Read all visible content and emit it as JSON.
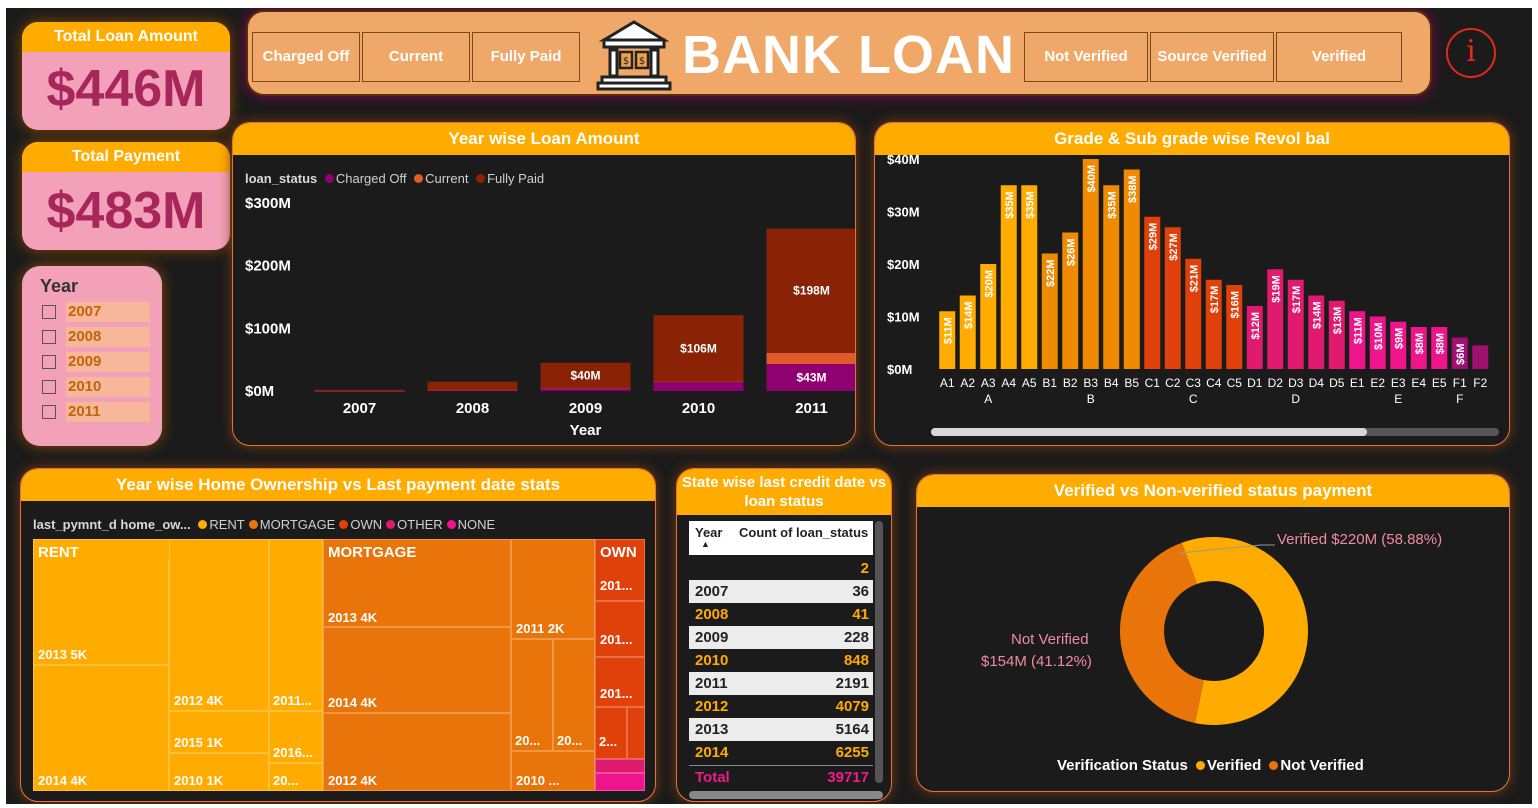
{
  "kpis": {
    "total_loan_label": "Total Loan Amount",
    "total_loan_value": "$446M",
    "total_payment_label": "Total Payment",
    "total_payment_value": "$483M"
  },
  "year_slicer": {
    "title": "Year",
    "options": [
      "2007",
      "2008",
      "2009",
      "2010",
      "2011"
    ]
  },
  "header": {
    "title": "BANK LOAN",
    "status_buttons": [
      "Charged Off",
      "Current",
      "Fully Paid"
    ],
    "verification_buttons": [
      "Not Verified",
      "Source Verified",
      "Verified"
    ],
    "info_icon": "i"
  },
  "colors": {
    "accent": "#ffab00",
    "charged_off": "#8f0070",
    "current": "#e05a2a",
    "fully_paid": "#8a2206",
    "kpi_bg": "#f3a1b9",
    "kpi_text": "#a8275a"
  },
  "year_chart": {
    "title": "Year wise Loan Amount",
    "legend_title": "loan_status",
    "legend": [
      "Charged Off",
      "Current",
      "Fully Paid"
    ],
    "xlabel": "Year",
    "yticks": [
      "$300M",
      "$200M",
      "$100M",
      "$0M"
    ]
  },
  "grade_chart": {
    "title": "Grade & Sub grade wise Revol bal",
    "yticks": [
      "$40M",
      "$30M",
      "$20M",
      "$10M",
      "$0M"
    ],
    "groups": [
      "A",
      "B",
      "C",
      "D",
      "E",
      "F"
    ]
  },
  "treemap": {
    "title": "Year wise Home Ownership vs Last payment date stats",
    "legend_title": "last_pymnt_d home_ow...",
    "legend": [
      "RENT",
      "MORTGAGE",
      "OWN",
      "OTHER",
      "NONE"
    ],
    "legend_colors": [
      "#ffab00",
      "#e8740a",
      "#e0400a",
      "#e01a6e",
      "#f0148c"
    ],
    "groups": [
      "RENT",
      "MORTGAGE",
      "OWN"
    ],
    "labels": {
      "rent_2013": "2013 5K",
      "rent_2014": "2014 4K",
      "rent_2012": "2012 4K",
      "rent_2011": "2011...",
      "rent_2015": "2015 1K",
      "rent_2016": "2016...",
      "rent_2010": "2010 1K",
      "rent_20x": "20...",
      "mort_2013": "2013 4K",
      "mort_2014": "2014 4K",
      "mort_2012": "2012 4K",
      "mort_2011": "2011 2K",
      "mort_20a": "20...",
      "mort_20b": "20...",
      "mort_2010": "2010 ...",
      "own_a": "201...",
      "own_b": "201...",
      "own_c": "201...",
      "own_d": "2..."
    }
  },
  "state_table": {
    "title": "State wise last credit date vs loan status",
    "headers": [
      "Year",
      "Count of loan_status"
    ],
    "rows": [
      {
        "year": "",
        "count": "2"
      },
      {
        "year": "2007",
        "count": "36"
      },
      {
        "year": "2008",
        "count": "41"
      },
      {
        "year": "2009",
        "count": "228"
      },
      {
        "year": "2010",
        "count": "848"
      },
      {
        "year": "2011",
        "count": "2191"
      },
      {
        "year": "2012",
        "count": "4079"
      },
      {
        "year": "2013",
        "count": "5164"
      },
      {
        "year": "2014",
        "count": "6255"
      }
    ],
    "total_label": "Total",
    "total_value": "39717"
  },
  "donut": {
    "title": "Verified vs Non-verified status payment",
    "verified_label": "Verified $220M (58.88%)",
    "not_verified_line1": "Not Verified",
    "not_verified_line2": "$154M (41.12%)",
    "legend_title": "Verification Status",
    "legend": [
      "Verified",
      "Not Verified"
    ]
  },
  "chart_data": [
    {
      "type": "bar",
      "title": "Year wise Loan Amount",
      "xlabel": "Year",
      "ylabel": "",
      "categories": [
        "2007",
        "2008",
        "2009",
        "2010",
        "2011"
      ],
      "series": [
        {
          "name": "Charged Off",
          "values": [
            0.3,
            2,
            5,
            15,
            43
          ]
        },
        {
          "name": "Current",
          "values": [
            0,
            0,
            0,
            0,
            18
          ]
        },
        {
          "name": "Fully Paid",
          "values": [
            1.5,
            13,
            40,
            106,
            198
          ]
        }
      ],
      "data_labels": [
        "",
        "",
        "$40M",
        "$106M",
        "$198M",
        "$43M"
      ],
      "ylim": [
        0,
        300
      ],
      "stacked": true,
      "legend_placement": "top-left",
      "grid": false
    },
    {
      "type": "bar",
      "title": "Grade & Sub grade wise Revol bal",
      "categories": [
        "A1",
        "A2",
        "A3",
        "A4",
        "A5",
        "B1",
        "B2",
        "B3",
        "B4",
        "B5",
        "C1",
        "C2",
        "C3",
        "C4",
        "C5",
        "D1",
        "D2",
        "D3",
        "D4",
        "D5",
        "E1",
        "E2",
        "E3",
        "E4",
        "E5",
        "F1",
        "F2"
      ],
      "group_labels": [
        "A",
        "B",
        "C",
        "D",
        "E",
        "F"
      ],
      "values": [
        11,
        14,
        20,
        35,
        35,
        22,
        26,
        40,
        35,
        38,
        29,
        27,
        21,
        17,
        16,
        12,
        19,
        17,
        14,
        13,
        11,
        10,
        9,
        8,
        8,
        6,
        4.5
      ],
      "data_labels": [
        "$11M",
        "$14M",
        "$20M",
        "$35M",
        "$35M",
        "$22M",
        "$26M",
        "$40M",
        "$35M",
        "$38M",
        "$29M",
        "$27M",
        "$21M",
        "$17M",
        "$16M",
        "$12M",
        "$19M",
        "$17M",
        "$14M",
        "$13M",
        "$11M",
        "$10M",
        "$9M",
        "$8M",
        "$8M",
        "$6M",
        ""
      ],
      "colors": [
        "#ffab00",
        "#ffab00",
        "#ffab00",
        "#ffab00",
        "#ffab00",
        "#f08a00",
        "#f08a00",
        "#f08a00",
        "#f08a00",
        "#f08a00",
        "#e0400a",
        "#e0400a",
        "#e0400a",
        "#e0400a",
        "#e0400a",
        "#e01a6e",
        "#e01a6e",
        "#e01a6e",
        "#e01a6e",
        "#e01a6e",
        "#f0148c",
        "#f0148c",
        "#f0148c",
        "#f0148c",
        "#f0148c",
        "#a01070",
        "#a01070"
      ],
      "ylim": [
        0,
        40
      ],
      "grid": false
    },
    {
      "type": "pie",
      "title": "Verified vs Non-verified status payment",
      "categories": [
        "Verified",
        "Not Verified"
      ],
      "values": [
        220,
        154
      ],
      "percent": [
        58.88,
        41.12
      ],
      "colors": [
        "#ffab00",
        "#e8740a"
      ],
      "legend_placement": "bottom"
    }
  ]
}
